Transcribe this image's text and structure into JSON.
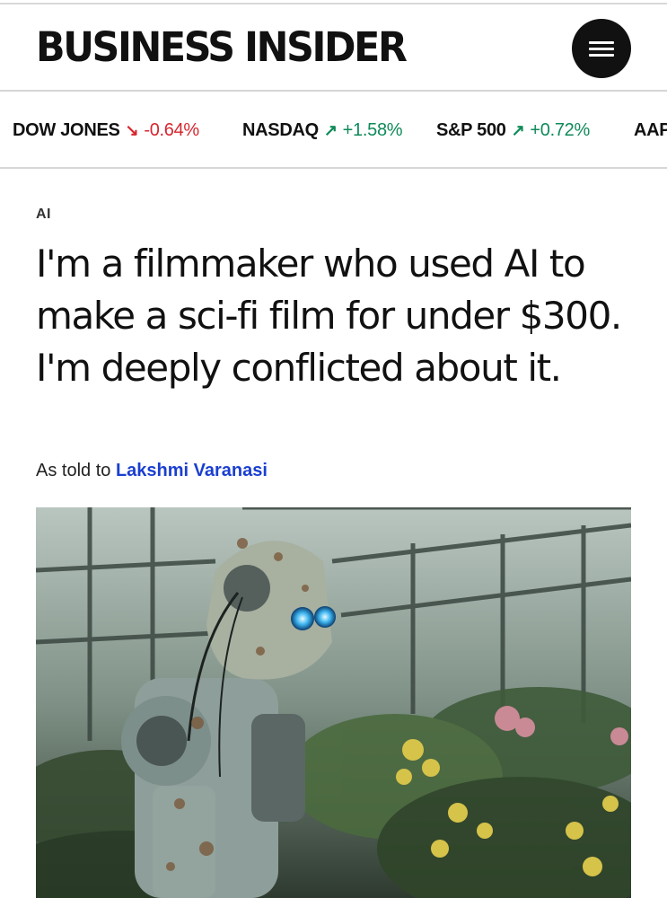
{
  "header": {
    "logo": "BUSINESS INSIDER",
    "menu_icon": "hamburger-menu-icon"
  },
  "ticker": [
    {
      "name": "DOW JONES",
      "direction": "down",
      "change": "-0.64%"
    },
    {
      "name": "NASDAQ",
      "direction": "up",
      "change": "+1.58%"
    },
    {
      "name": "S&P 500",
      "direction": "up",
      "change": "+0.72%"
    },
    {
      "name": "AAPL",
      "direction": "up",
      "change": ""
    }
  ],
  "article": {
    "category": "AI",
    "headline": "I'm a filmmaker who used AI to make a sci-fi film for under $300. I'm deeply conflicted about it.",
    "byline_prefix": "As told to",
    "author": "Lakshmi Varanasi",
    "hero_image": "robot-in-greenhouse-image"
  },
  "colors": {
    "down": "#d6262f",
    "up": "#0f8a5a",
    "author_link": "#1a3fd0"
  }
}
